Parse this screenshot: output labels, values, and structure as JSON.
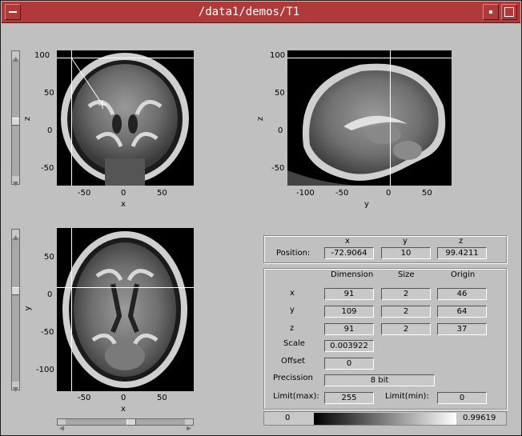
{
  "window": {
    "title": "/data1/demos/T1"
  },
  "views": {
    "coronal": {
      "xlabel": "x",
      "ylabel": "z",
      "xticks": [
        "-50",
        "0",
        "50"
      ],
      "yticks": [
        "100",
        "50",
        "0",
        "-50"
      ]
    },
    "sagittal": {
      "xlabel": "y",
      "ylabel": "z",
      "xticks": [
        "-100",
        "-50",
        "0",
        "50"
      ],
      "yticks": [
        "100",
        "50",
        "0",
        "-50"
      ]
    },
    "axial": {
      "xlabel": "x",
      "ylabel": "y",
      "xticks": [
        "-50",
        "0",
        "50"
      ],
      "yticks": [
        "50",
        "0",
        "-50",
        "-100"
      ]
    }
  },
  "position": {
    "label": "Position:",
    "headers": [
      "x",
      "y",
      "z"
    ],
    "values": [
      "-72.9064",
      "10",
      "99.4211"
    ]
  },
  "info": {
    "headers": [
      "Dimension",
      "Size",
      "Origin"
    ],
    "rows": [
      {
        "label": "x",
        "dimension": "91",
        "size": "2",
        "origin": "46"
      },
      {
        "label": "y",
        "dimension": "109",
        "size": "2",
        "origin": "64"
      },
      {
        "label": "z",
        "dimension": "91",
        "size": "2",
        "origin": "37"
      }
    ],
    "scale_label": "Scale",
    "scale": "0.003922",
    "offset_label": "Offset",
    "offset": "0",
    "precision_label": "Precission",
    "precision": "8 bit",
    "limit_max_label": "Limit(max):",
    "limit_max": "255",
    "limit_min_label": "Limit(min):",
    "limit_min": "0"
  },
  "colorbar": {
    "min": "0",
    "max": "0.99619"
  }
}
